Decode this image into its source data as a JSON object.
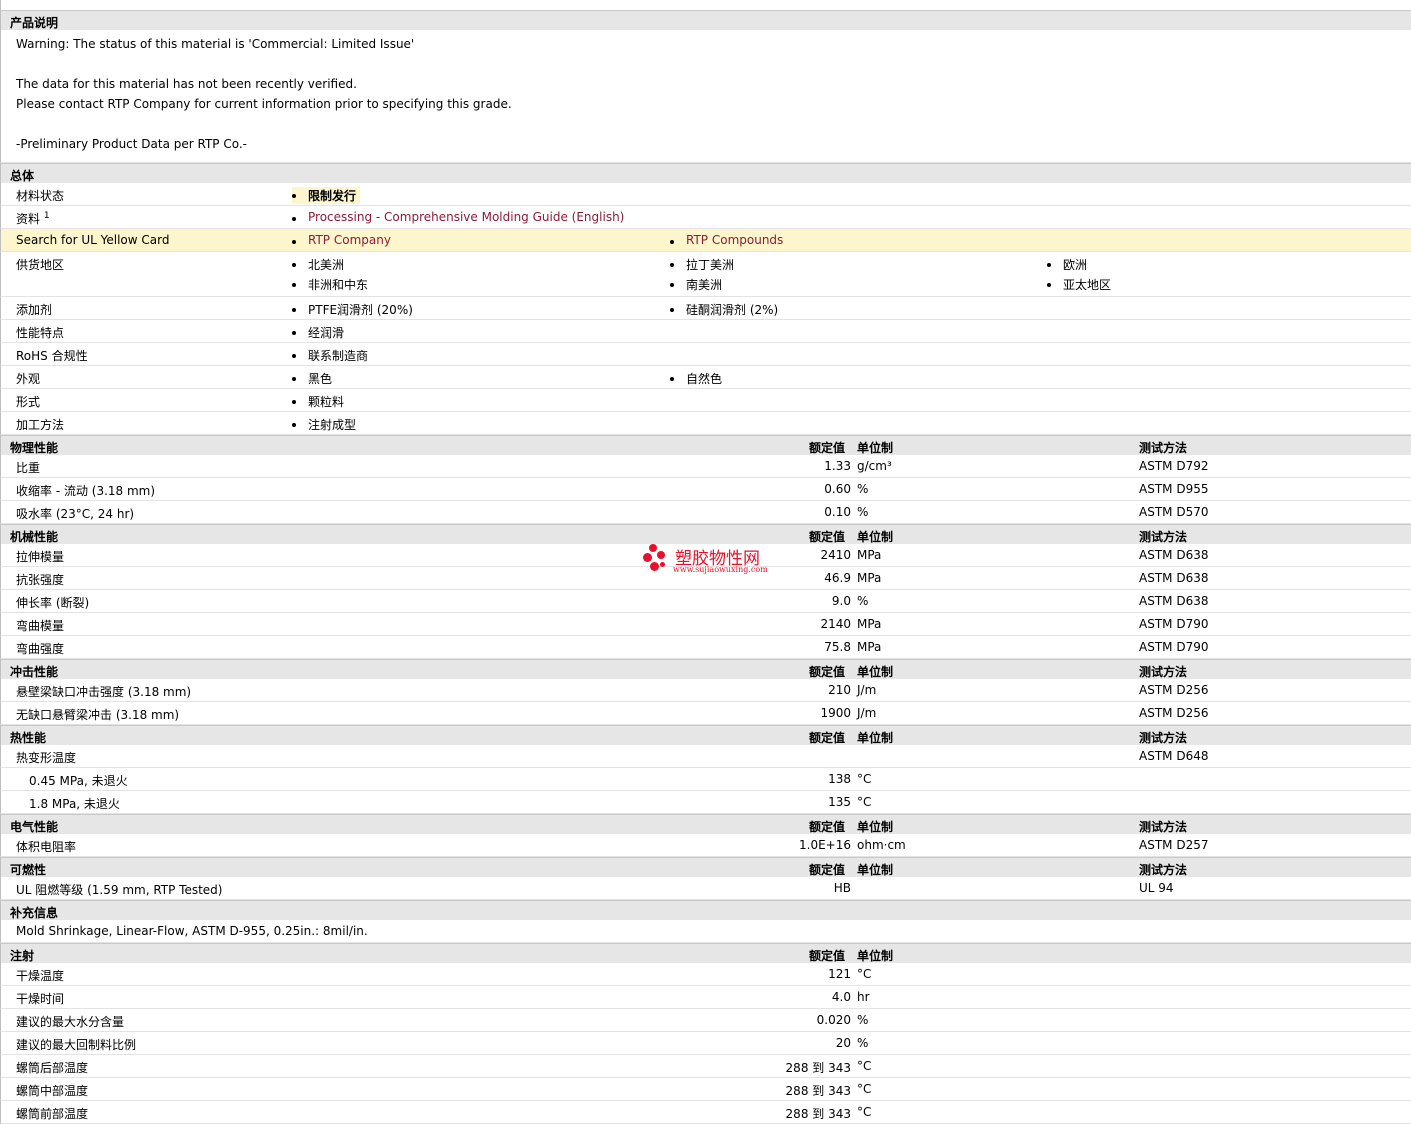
{
  "desc": {
    "title": "产品说明",
    "lines": [
      "Warning: The status of this material is 'Commercial: Limited Issue'",
      "",
      "The data for this material has not been recently verified.",
      "Please contact RTP Company for current information prior to specifying this grade.",
      "",
      "-Preliminary Product Data per RTP Co.-"
    ]
  },
  "general": {
    "title": "总体",
    "rows": [
      {
        "label": "材料状态",
        "items": [
          [
            "限制发行"
          ]
        ]
      },
      {
        "label": "资料",
        "sup": "1",
        "items": [
          [
            "Processing - Comprehensive Molding Guide (English)"
          ]
        ]
      },
      {
        "label": "Search for UL Yellow Card",
        "items": [
          [
            "RTP Company"
          ],
          [
            "RTP Compounds"
          ]
        ]
      },
      {
        "label": "供货地区",
        "items": [
          [
            "北美洲",
            "非洲和中东"
          ],
          [
            "拉丁美洲",
            "南美洲"
          ],
          [
            "欧洲",
            "亚太地区"
          ]
        ]
      },
      {
        "label": "添加剂",
        "items": [
          [
            "PTFE润滑剂 (20%)"
          ],
          [
            "硅酮润滑剂 (2%)"
          ]
        ]
      },
      {
        "label": "性能特点",
        "items": [
          [
            "经润滑"
          ]
        ]
      },
      {
        "label": "RoHS 合规性",
        "items": [
          [
            "联系制造商"
          ]
        ]
      },
      {
        "label": "外观",
        "items": [
          [
            "黑色"
          ],
          [
            "自然色"
          ]
        ]
      },
      {
        "label": "形式",
        "items": [
          [
            "颗粒料"
          ]
        ]
      },
      {
        "label": "加工方法",
        "items": [
          [
            "注射成型"
          ]
        ]
      }
    ]
  },
  "headers": {
    "value": "额定值",
    "unit": "单位制",
    "method": "测试方法"
  },
  "physical": {
    "title": "物理性能",
    "rows": [
      {
        "label": "比重",
        "value": "1.33",
        "unit": "g/cm³",
        "method": "ASTM D792"
      },
      {
        "label": "收缩率  - 流动  (3.18 mm)",
        "value": "0.60",
        "unit": "%",
        "method": "ASTM D955"
      },
      {
        "label": "吸水率  (23°C, 24 hr)",
        "value": "0.10",
        "unit": "%",
        "method": "ASTM D570"
      }
    ]
  },
  "mechanical": {
    "title": "机械性能",
    "rows": [
      {
        "label": "拉伸模量",
        "value": "2410",
        "unit": "MPa",
        "method": "ASTM D638"
      },
      {
        "label": "抗张强度",
        "value": "46.9",
        "unit": "MPa",
        "method": "ASTM D638"
      },
      {
        "label": "伸长率  (断裂)",
        "value": "9.0",
        "unit": "%",
        "method": "ASTM D638"
      },
      {
        "label": "弯曲模量",
        "value": "2140",
        "unit": "MPa",
        "method": "ASTM D790"
      },
      {
        "label": "弯曲强度",
        "value": "75.8",
        "unit": "MPa",
        "method": "ASTM D790"
      }
    ]
  },
  "impact": {
    "title": "冲击性能",
    "rows": [
      {
        "label": "悬壁梁缺口冲击强度  (3.18 mm)",
        "value": "210",
        "unit": "J/m",
        "method": "ASTM D256"
      },
      {
        "label": "无缺口悬臂梁冲击  (3.18 mm)",
        "value": "1900",
        "unit": "J/m",
        "method": "ASTM D256"
      }
    ]
  },
  "thermal": {
    "title": "热性能",
    "rows": [
      {
        "label": "热变形温度",
        "value": "",
        "unit": "",
        "method": "ASTM D648"
      },
      {
        "label": "0.45 MPa, 未退火",
        "value": "138",
        "unit": "°C",
        "method": "",
        "indent": true
      },
      {
        "label": "1.8 MPa, 未退火",
        "value": "135",
        "unit": "°C",
        "method": "",
        "indent": true
      }
    ]
  },
  "electrical": {
    "title": "电气性能",
    "rows": [
      {
        "label": "体积电阻率",
        "value": "1.0E+16",
        "unit": "ohm·cm",
        "method": "ASTM D257"
      }
    ]
  },
  "flammability": {
    "title": "可燃性",
    "rows": [
      {
        "label": "UL 阻燃等级  (1.59 mm, RTP Tested)",
        "value": "HB",
        "unit": "",
        "method": "UL 94"
      }
    ]
  },
  "supplement": {
    "title": "补充信息",
    "text": "Mold Shrinkage, Linear-Flow, ASTM D-955, 0.25in.: 8mil/in."
  },
  "injection": {
    "title": "注射",
    "rows": [
      {
        "label": "干燥温度",
        "value": "121",
        "unit": "°C"
      },
      {
        "label": "干燥时间",
        "value": "4.0",
        "unit": "hr"
      },
      {
        "label": "建议的最大水分含量",
        "value": "0.020",
        "unit": "%"
      },
      {
        "label": "建议的最大回制料比例",
        "value": "20",
        "unit": "%"
      },
      {
        "label": "螺筒后部温度",
        "value": "288 到  343",
        "unit": "°C"
      },
      {
        "label": "螺筒中部温度",
        "value": "288 到  343",
        "unit": "°C"
      },
      {
        "label": "螺筒前部温度",
        "value": "288 到  343",
        "unit": "°C"
      }
    ]
  },
  "watermark": {
    "cn": "塑胶物性网",
    "url": "www.sujiaowuxing.com"
  }
}
